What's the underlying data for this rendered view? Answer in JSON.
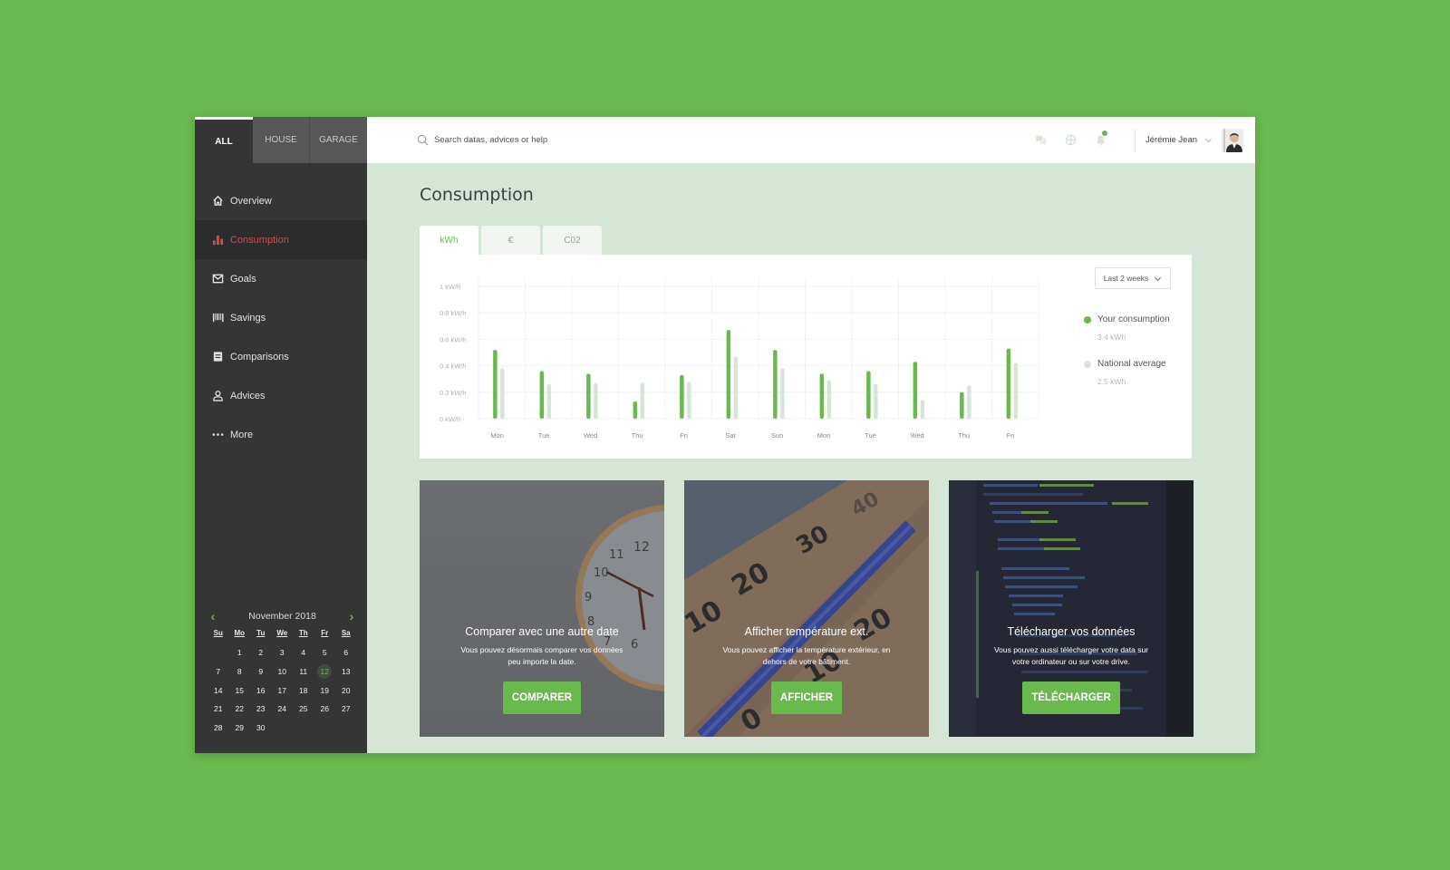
{
  "scope_tabs": [
    {
      "label": "ALL",
      "active": true
    },
    {
      "label": "HOUSE",
      "active": false
    },
    {
      "label": "GARAGE",
      "active": false
    }
  ],
  "sidebar": {
    "items": [
      {
        "label": "Overview",
        "icon": "home-icon",
        "active": false
      },
      {
        "label": "Consumption",
        "icon": "bar-chart-icon",
        "active": true
      },
      {
        "label": "Goals",
        "icon": "envelope-icon",
        "active": false
      },
      {
        "label": "Savings",
        "icon": "barcode-icon",
        "active": false
      },
      {
        "label": "Comparisons",
        "icon": "document-icon",
        "active": false
      },
      {
        "label": "Advices",
        "icon": "user-icon",
        "active": false
      },
      {
        "label": "More",
        "icon": "ellipsis-icon",
        "active": false
      }
    ]
  },
  "calendar": {
    "title": "November 2018",
    "prev": "‹",
    "next": "›",
    "weekdays": [
      "Su",
      "Mo",
      "Tu",
      "We",
      "Th",
      "Fr",
      "Sa"
    ],
    "first_weekday_offset": 1,
    "days_in_month": 30,
    "selected_day": 12
  },
  "header": {
    "search_placeholder": "Search datas, advices or help",
    "user_name": "Jérémie Jean",
    "notification_badge": true,
    "icons": [
      "chat-icon",
      "globe-icon",
      "bell-icon"
    ]
  },
  "main": {
    "title": "Consumption",
    "unit_tabs": [
      {
        "label": "kWh",
        "active": true
      },
      {
        "label": "€",
        "active": false
      },
      {
        "label": "C02",
        "active": false
      }
    ],
    "period_select": "Last 2 weeks",
    "legend": [
      {
        "label": "Your consumption",
        "value": "3.4 kWh",
        "color": "#69b94f"
      },
      {
        "label": "National average",
        "value": "2.5 kWh",
        "color": "#d5e6d7"
      }
    ]
  },
  "chart_data": {
    "type": "bar",
    "title": "",
    "xlabel": "",
    "ylabel": "",
    "ylim": [
      0,
      1
    ],
    "yticks": [
      0,
      0.2,
      0.4,
      0.6,
      0.8,
      1
    ],
    "ytick_labels": [
      "0 kW/h",
      "0.2 kW/h",
      "0.4 kW/h",
      "0.6 kW/h",
      "0.8 kW/h",
      "1 kW/h"
    ],
    "categories": [
      "Mon",
      "Tue",
      "Wed",
      "Thu",
      "Fri",
      "Sat",
      "Sun",
      "Mon",
      "Tue",
      "Wed",
      "Thu",
      "Fri"
    ],
    "grid": true,
    "legend_position": "right",
    "series": [
      {
        "name": "Your consumption",
        "color": "#69b94f",
        "values": [
          0.52,
          0.36,
          0.34,
          0.13,
          0.33,
          0.67,
          0.52,
          0.34,
          0.36,
          0.43,
          0.2,
          0.53
        ]
      },
      {
        "name": "National average",
        "color": "#d5e6d7",
        "values": [
          0.38,
          0.26,
          0.27,
          0.27,
          0.28,
          0.47,
          0.38,
          0.29,
          0.26,
          0.14,
          0.25,
          0.42
        ]
      }
    ]
  },
  "cards": [
    {
      "title": "Comparer avec une autre date",
      "text": "Vous pouvez désormais comparer vos données peu importe la date.",
      "button": "COMPARER",
      "image": "clock"
    },
    {
      "title": "Afficher température ext.",
      "text": "Vous pouvez afficher la température extérieur, en dehors de votre bâtiment.",
      "button": "AFFICHER",
      "image": "thermometer"
    },
    {
      "title": "Télécharger vos données",
      "text": "Vous pouvez aussi télécharger votre data sur votre ordinateur ou sur votre drive.",
      "button": "TÉLÉCHARGER",
      "image": "code"
    }
  ]
}
